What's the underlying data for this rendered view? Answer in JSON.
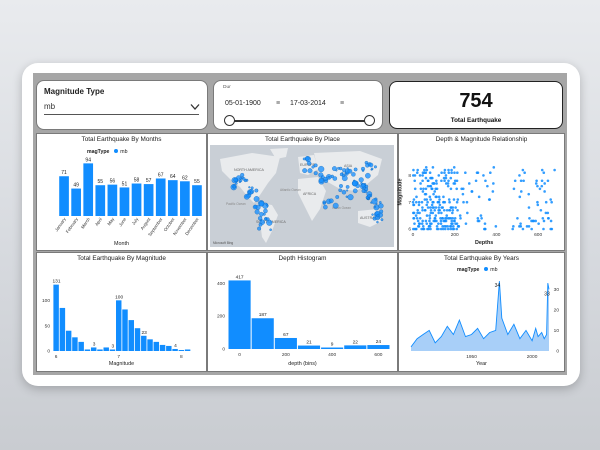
{
  "filters": {
    "magnitude_type": {
      "label": "Magnitude Type",
      "value": "mb"
    },
    "date_range": {
      "caption": "Dur",
      "start": "05-01-1900",
      "end": "17-03-2014"
    },
    "kpi": {
      "value": "754",
      "label": "Total Earthquake"
    }
  },
  "chart_data": [
    {
      "type": "bar",
      "title": "Total Earthquake By Months",
      "legend_title": "magType",
      "legend": [
        "mb"
      ],
      "xlabel": "Month",
      "categories": [
        "January",
        "February",
        "March",
        "April",
        "May",
        "June",
        "July",
        "August",
        "September",
        "October",
        "November",
        "December"
      ],
      "values": [
        71,
        49,
        94,
        55,
        56,
        51,
        58,
        57,
        67,
        64,
        62,
        55
      ],
      "colors": {
        "bar": "#118DFF"
      }
    },
    {
      "type": "scatter",
      "title": "Total Earthquake By Place",
      "map_labels": [
        "NORTH AMERICA",
        "SOUTH AMERICA",
        "EUROPE",
        "AFRICA",
        "ASIA",
        "AUSTRALIA",
        "Atlantic Ocean",
        "Pacific Ocean",
        "Indian Ocean"
      ],
      "attribution": "Microsoft Bing"
    },
    {
      "type": "scatter",
      "title": "Depth & Magnitude Relationship",
      "xlabel": "Depths",
      "ylabel": "Magnitude",
      "xticks": [
        "0",
        "200",
        "400",
        "600"
      ],
      "yticks": [
        "6",
        "7",
        "8"
      ],
      "xlim": [
        0,
        700
      ],
      "ylim": [
        6,
        8.5
      ]
    },
    {
      "type": "bar",
      "title": "Total Earthquake By Magnitude",
      "xlabel": "Magnitude",
      "xticks": [
        "6",
        "7",
        "8"
      ],
      "yticks": [
        "0",
        "50",
        "100"
      ],
      "ylim": [
        0,
        150
      ],
      "x": [
        6.0,
        6.1,
        6.2,
        6.3,
        6.4,
        6.5,
        6.6,
        6.7,
        6.8,
        6.9,
        7.0,
        7.1,
        7.2,
        7.3,
        7.4,
        7.5,
        7.6,
        7.7,
        7.8,
        7.9,
        8.0,
        8.1,
        8.2
      ],
      "values": [
        131,
        85,
        40,
        27,
        18,
        3,
        7,
        3,
        7,
        3,
        100,
        82,
        61,
        45,
        30,
        23,
        18,
        12,
        10,
        4,
        2,
        3,
        0
      ],
      "data_labels": {
        "0": "131",
        "6": "3",
        "9": "3",
        "10": "100",
        "14": "23",
        "19": "4"
      },
      "colors": {
        "bar": "#118DFF"
      }
    },
    {
      "type": "bar",
      "title": "Depth Histogram",
      "xlabel": "depth (bins)",
      "xticks": [
        "0",
        "200",
        "400",
        "600"
      ],
      "yticks": [
        "0",
        "200",
        "400"
      ],
      "ylim": [
        0,
        450
      ],
      "bin_width": 100,
      "x": [
        0,
        100,
        200,
        300,
        400,
        500,
        600
      ],
      "values": [
        417,
        187,
        67,
        21,
        9,
        22,
        24
      ],
      "colors": {
        "bar": "#118DFF"
      }
    },
    {
      "type": "area",
      "title": "Total Earthquake By Years",
      "legend_title": "magType",
      "legend": [
        "mb"
      ],
      "xlabel": "Year",
      "xticks": [
        "1950",
        "2000"
      ],
      "yticks": [
        "0",
        "10",
        "20",
        "30"
      ],
      "xlim": [
        1900,
        2014
      ],
      "ylim": [
        0,
        35
      ],
      "x": [
        1900,
        1905,
        1910,
        1915,
        1920,
        1925,
        1930,
        1935,
        1940,
        1945,
        1950,
        1955,
        1960,
        1965,
        1970,
        1973,
        1975,
        1980,
        1985,
        1990,
        1995,
        2000,
        2003,
        2005,
        2008,
        2010,
        2012,
        2013,
        2014
      ],
      "values": [
        2,
        6,
        8,
        10,
        4,
        7,
        12,
        8,
        15,
        7,
        8,
        11,
        6,
        9,
        10,
        34,
        16,
        8,
        13,
        6,
        10,
        5,
        11,
        7,
        9,
        6,
        8,
        33,
        30
      ],
      "data_labels": {
        "15": "34",
        "28": "33"
      },
      "colors": {
        "area": "#118DFF",
        "fill": "#9fcaf7"
      }
    }
  ]
}
